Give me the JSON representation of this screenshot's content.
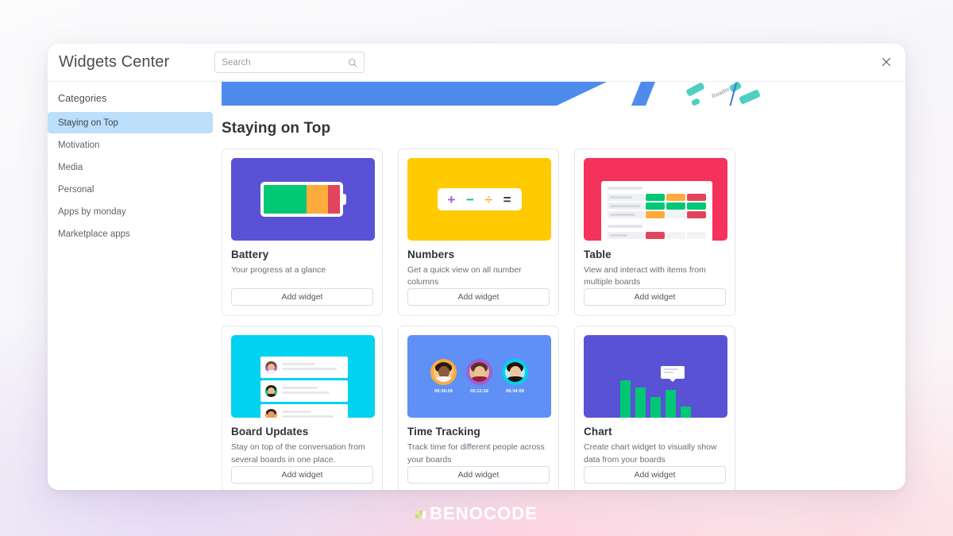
{
  "window": {
    "title": "Widgets Center",
    "close_icon": "close-icon"
  },
  "search": {
    "placeholder": "Search",
    "value": "",
    "icon": "search-icon"
  },
  "sidebar": {
    "heading": "Categories",
    "items": [
      {
        "label": "Staying on Top",
        "active": true
      },
      {
        "label": "Motivation",
        "active": false
      },
      {
        "label": "Media",
        "active": false
      },
      {
        "label": "Personal",
        "active": false
      },
      {
        "label": "Apps by monday",
        "active": false
      },
      {
        "label": "Marketplace apps",
        "active": false
      }
    ]
  },
  "banner": {
    "word": "Roadm"
  },
  "main": {
    "section_title": "Staying on Top",
    "add_widget_label": "Add widget",
    "cards": [
      {
        "title": "Battery",
        "description": "Your progress at a glance",
        "thumb": "battery",
        "accent": "#5a52d5"
      },
      {
        "title": "Numbers",
        "description": "Get a quick view on all number columns",
        "thumb": "numbers",
        "accent": "#ffcb00",
        "operators": [
          "+",
          "−",
          "÷",
          "="
        ]
      },
      {
        "title": "Table",
        "description": "View and interact with items from multiple boards",
        "thumb": "table",
        "accent": "#f5325b"
      },
      {
        "title": "Board Updates",
        "description": "Stay on top of the conversation from several boards in one place.",
        "thumb": "board",
        "accent": "#00d2f0"
      },
      {
        "title": "Time Tracking",
        "description": "Track time for different people across your boards",
        "thumb": "time",
        "accent": "#5f90f5",
        "timers": [
          "09:35:04",
          "05:12:34",
          "06:34:09"
        ]
      },
      {
        "title": "Chart",
        "description": "Create chart widget to visually show data from your boards",
        "thumb": "chart",
        "accent": "#5a52d5"
      }
    ]
  },
  "watermark": {
    "text": "BENOCODE"
  },
  "colors": {
    "green": "#00c875",
    "orange": "#fdab3d",
    "red": "#e2445c",
    "purple": "#5a52d5",
    "yellow": "#ffcb00",
    "pink": "#f5325b",
    "cyan": "#00d2f0",
    "blue": "#5f90f5",
    "sidebar_active": "#bcdffb"
  }
}
